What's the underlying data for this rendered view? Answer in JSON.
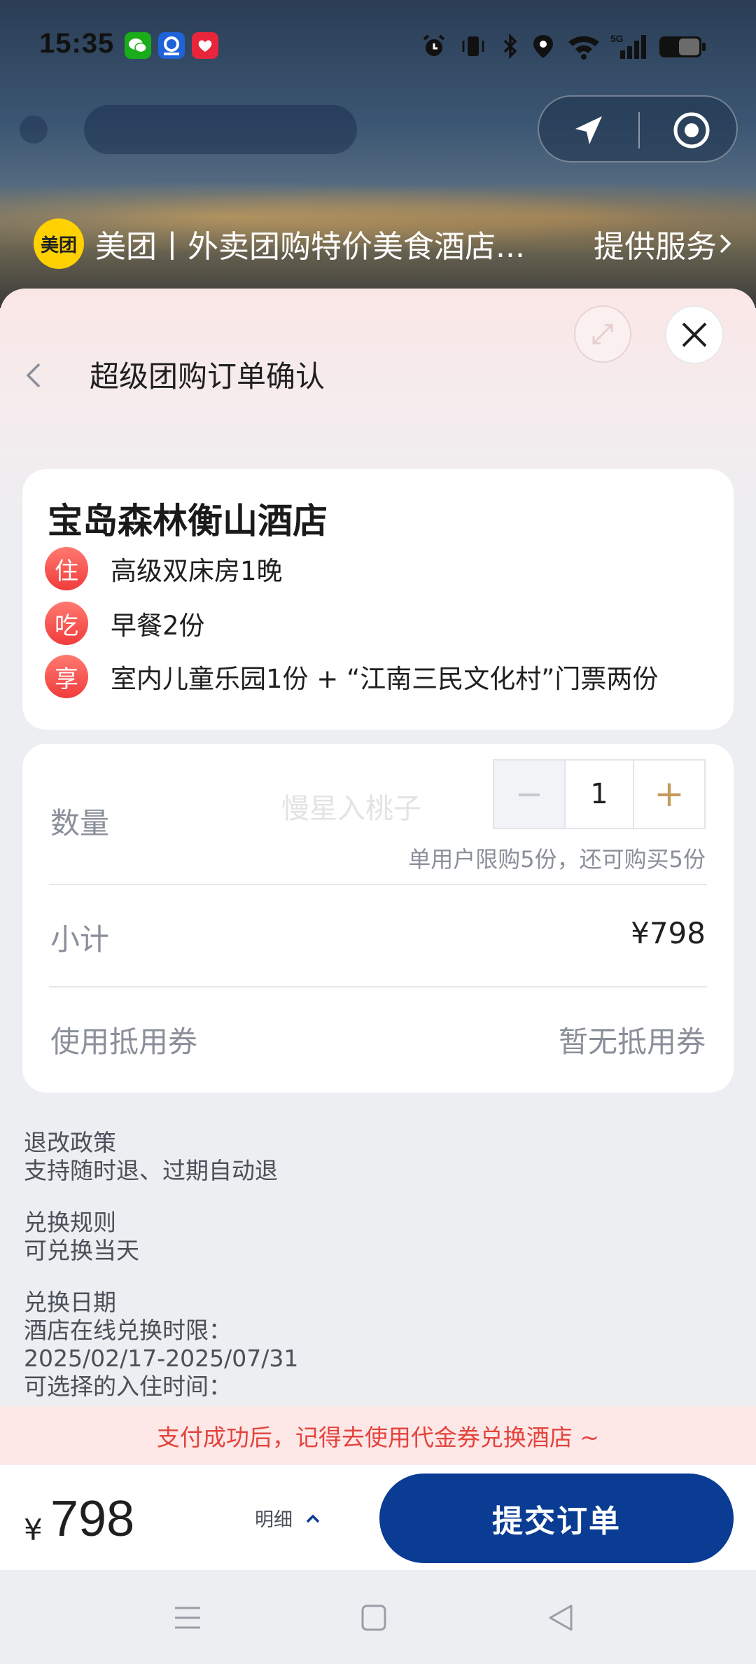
{
  "status_bar": {
    "time": "15:35",
    "battery": "44",
    "network": "5G"
  },
  "mini_program": {
    "logo_text": "美团",
    "name": "美团丨外卖团购特价美食酒店...",
    "service_label": "提供服务"
  },
  "page": {
    "title": "超级团购订单确认"
  },
  "hotel": {
    "name": "宝岛森林衡山酒店",
    "features": [
      {
        "tag": "住",
        "text": "高级双床房1晚"
      },
      {
        "tag": "吃",
        "text": "早餐2份"
      },
      {
        "tag": "享",
        "text": "室内儿童乐园1份 + “江南三民文化村”门票两份"
      }
    ]
  },
  "order": {
    "quantity_label": "数量",
    "watermark": "慢星入桃子",
    "minus": "−",
    "quantity": "1",
    "plus": "+",
    "limit_note": "单用户限购5份，还可购买5份",
    "subtotal_label": "小计",
    "subtotal_value": "¥798",
    "coupon_label": "使用抵用券",
    "coupon_value": "暂无抵用券"
  },
  "policies": {
    "refund_title": "退改政策",
    "refund_text": "支持随时退、过期自动退",
    "exchange_title": "兑换规则",
    "exchange_text": "可兑换当天",
    "date_title": "兑换日期",
    "date_line1": "酒店在线兑换时限：",
    "date_line2": "2025/02/17-2025/07/31",
    "date_line3": "可选择的入住时间："
  },
  "tip": "支付成功后，记得去使用代金券兑换酒店 ~",
  "footer": {
    "currency": "¥",
    "price": "798",
    "detail_label": "明细",
    "submit_label": "提交订单"
  },
  "colors": {
    "primary": "#0a3c94",
    "tag_red": "#f03c3c",
    "tip_text": "#e4433d",
    "plus_gold": "#c49a5a"
  }
}
